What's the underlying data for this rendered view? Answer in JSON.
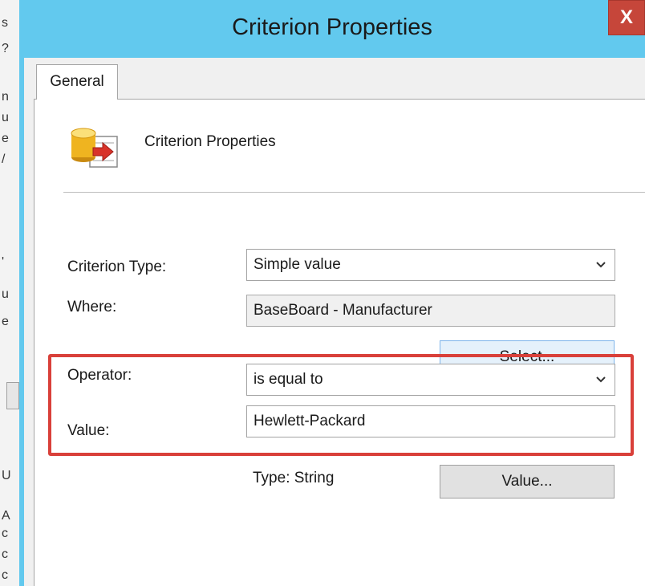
{
  "background_window": {
    "edge_chars": [
      "s",
      "?",
      "n",
      "u",
      "e",
      "/",
      "'",
      "u",
      "e",
      "U",
      "A",
      "c",
      "c",
      "c"
    ]
  },
  "dialog": {
    "title": "Criterion Properties",
    "close_label": "X",
    "tabs": [
      {
        "label": "General",
        "selected": true
      }
    ],
    "header": {
      "icon": "database-arrow-icon",
      "label": "Criterion Properties"
    },
    "fields": {
      "criterion_type": {
        "label": "Criterion Type:",
        "value": "Simple value"
      },
      "where": {
        "label": "Where:",
        "value": "BaseBoard - Manufacturer"
      },
      "operator": {
        "label": "Operator:",
        "value": "is equal to"
      },
      "value": {
        "label": "Value:",
        "value": "Hewlett-Packard"
      }
    },
    "select_button": "Select...",
    "type_text": "Type: String",
    "value_button": "Value..."
  },
  "colors": {
    "title_bar": "#62c9ee",
    "close_button": "#c6463a",
    "highlight_box": "#d9403a"
  }
}
